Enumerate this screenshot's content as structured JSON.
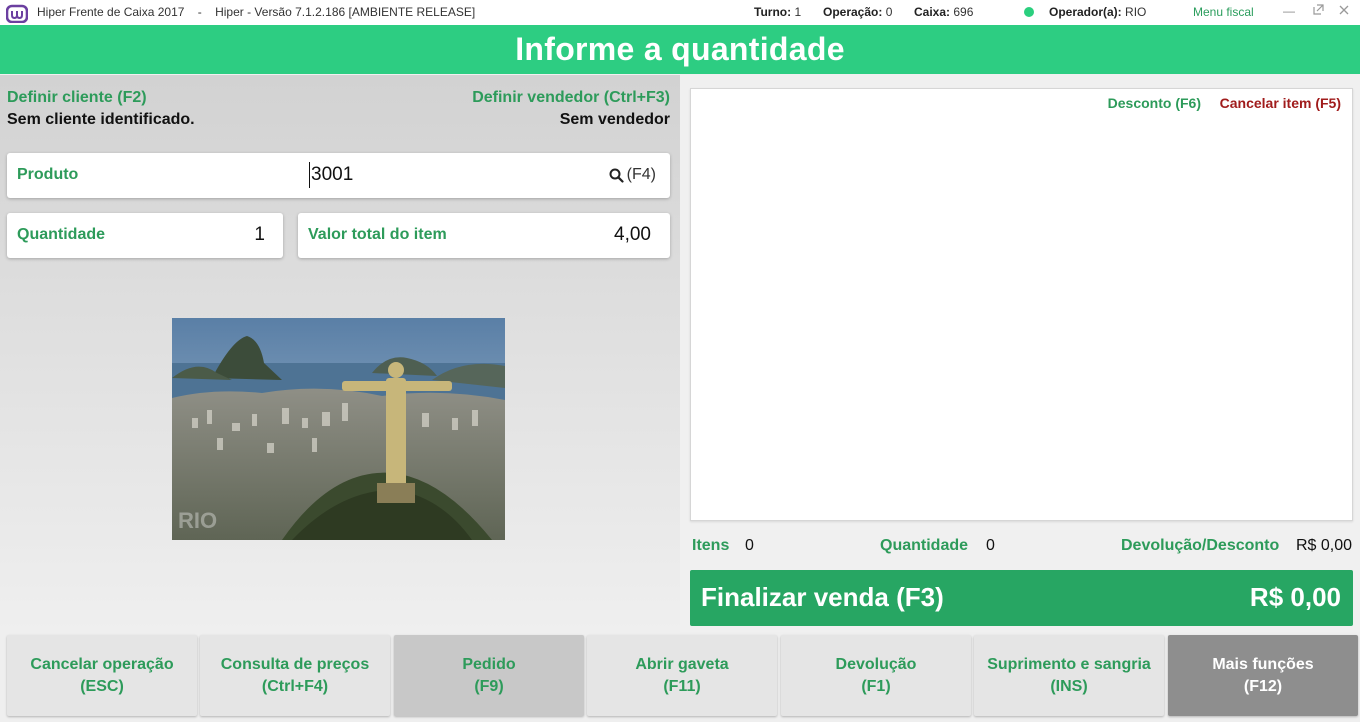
{
  "titlebar": {
    "app_title": "Hiper Frente de Caixa 2017    -    Hiper - Versão 7.1.2.186 [AMBIENTE RELEASE]",
    "turno_label": "Turno:",
    "turno_value": "1",
    "operacao_label": "Operação:",
    "operacao_value": "0",
    "caixa_label": "Caixa:",
    "caixa_value": "696",
    "operador_label": "Operador(a):",
    "operador_value": "RIO",
    "menu_fiscal": "Menu fiscal",
    "status_color": "#2bcf7e"
  },
  "header": {
    "title": "Informe a quantidade",
    "color": "#2dcd82"
  },
  "client": {
    "label": "Definir cliente (F2)",
    "value": "Sem cliente identificado."
  },
  "seller": {
    "label": "Definir vendedor (Ctrl+F3)",
    "value": "Sem vendedor"
  },
  "produto": {
    "label": "Produto",
    "value": "3001",
    "search_label": "(F4)",
    "search_icon": "search-icon"
  },
  "quantidade": {
    "label": "Quantidade",
    "value": "1"
  },
  "valor_total": {
    "label": "Valor total do item",
    "value": "4,00"
  },
  "product_image": {
    "watermark": "RIO"
  },
  "item_list": {
    "discount_link": "Desconto (F6)",
    "cancel_item_link": "Cancelar item (F5)"
  },
  "summary": {
    "itens_label": "Itens",
    "itens_value": "0",
    "quantidade_label": "Quantidade",
    "quantidade_value": "0",
    "devolucao_label": "Devolução/Desconto",
    "devolucao_value": "R$ 0,00"
  },
  "finalize": {
    "label": "Finalizar venda (F3)",
    "total": "R$ 0,00",
    "color": "#27a663"
  },
  "toolbar": {
    "buttons": [
      {
        "line1": "Cancelar operação",
        "line2": "(ESC)"
      },
      {
        "line1": "Consulta de preços",
        "line2": "(Ctrl+F4)"
      },
      {
        "line1": "Pedido",
        "line2": "(F9)"
      },
      {
        "line1": "Abrir gaveta",
        "line2": "(F11)"
      },
      {
        "line1": "Devolução",
        "line2": "(F1)"
      },
      {
        "line1": "Suprimento e sangria",
        "line2": "(INS)"
      },
      {
        "line1": "Mais funções",
        "line2": "(F12)"
      }
    ]
  }
}
